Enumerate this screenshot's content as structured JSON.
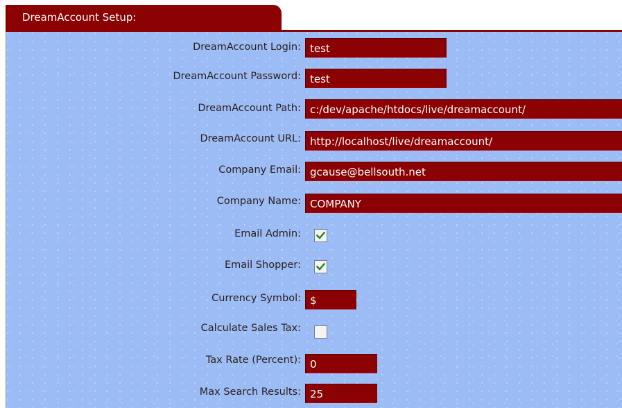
{
  "panel": {
    "title": "DreamAccount Setup:"
  },
  "fields": {
    "login": {
      "label": "DreamAccount Login:",
      "value": "test"
    },
    "password": {
      "label": "DreamAccount Password:",
      "value": "test"
    },
    "path": {
      "label": "DreamAccount Path:",
      "value": "c:/dev/apache/htdocs/live/dreamaccount/"
    },
    "url": {
      "label": "DreamAccount URL:",
      "value": "http://localhost/live/dreamaccount/"
    },
    "company_email": {
      "label": "Company Email:",
      "value": "gcause@bellsouth.net"
    },
    "company_name": {
      "label": "Company Name:",
      "value": "COMPANY"
    },
    "email_admin": {
      "label": "Email Admin:",
      "checked": true
    },
    "email_shopper": {
      "label": "Email Shopper:",
      "checked": true
    },
    "currency_symbol": {
      "label": "Currency Symbol:",
      "value": "$"
    },
    "calculate_sales_tax": {
      "label": "Calculate Sales Tax:",
      "checked": false
    },
    "tax_rate": {
      "label": "Tax Rate (Percent):",
      "value": "0"
    },
    "max_search_results": {
      "label": "Max Search Results:",
      "value": "25"
    }
  },
  "colors": {
    "panel_bg": "#9cbcf5",
    "accent": "#8b0000",
    "check": "#1e8a16"
  }
}
